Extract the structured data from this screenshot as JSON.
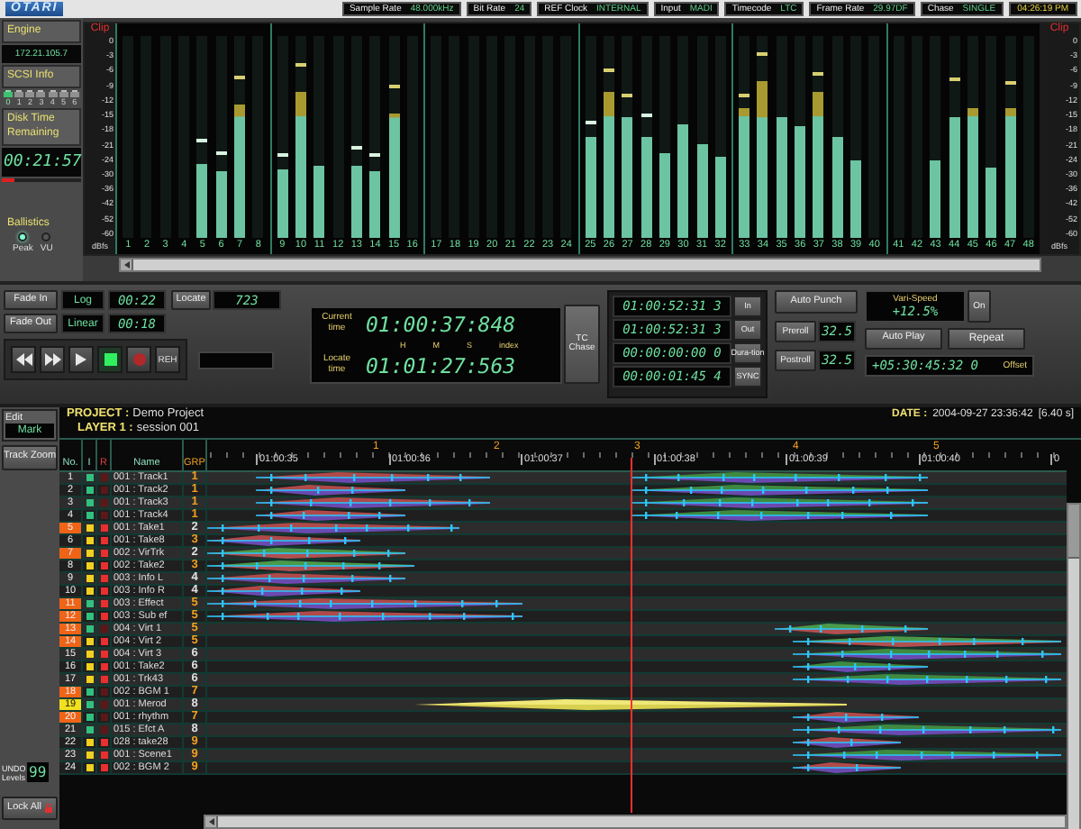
{
  "header": {
    "logo": "OTARI",
    "status": [
      {
        "label": "Sample Rate",
        "value": "48.000kHz"
      },
      {
        "label": "Bit Rate",
        "value": "24"
      },
      {
        "label": "REF Clock",
        "value": "INTERNAL"
      },
      {
        "label": "Input",
        "value": "MADI"
      },
      {
        "label": "Timecode",
        "value": "LTC"
      },
      {
        "label": "Frame Rate",
        "value": "29.97DF"
      },
      {
        "label": "Chase",
        "value": "SINGLE"
      }
    ],
    "clock": "04:26:19 PM"
  },
  "engine": {
    "title": "Engine",
    "address": "172.21.105.7",
    "scsi": "SCSI Info",
    "disks": [
      {
        "label": "0",
        "active": true
      },
      {
        "label": "1",
        "active": false
      },
      {
        "label": "2",
        "active": false
      },
      {
        "label": "3",
        "active": false
      },
      {
        "label": "4",
        "active": false
      },
      {
        "label": "5",
        "active": false
      },
      {
        "label": "6",
        "active": false
      }
    ],
    "disk_time_label": "Disk Time Remaining",
    "disk_time": "00:21:57",
    "disk_usage": {
      "level": 0.15
    },
    "ballistics": {
      "title": "Ballistics",
      "options": [
        {
          "label": "Peak",
          "selected": true
        },
        {
          "label": "VU",
          "selected": false
        }
      ]
    }
  },
  "meters": {
    "left_scale": {
      "clip": "Clip",
      "marks": [
        "0",
        "-3",
        "-6",
        "-9",
        "-12",
        "-15",
        "-18",
        "-21",
        "-24",
        "-30",
        "-36",
        "-42",
        "-52",
        "-60"
      ],
      "unit": "dBfs"
    },
    "right_scale": {
      "clip": "Clip",
      "marks": [
        "0",
        "-3",
        "-6",
        "-9",
        "-12",
        "-15",
        "-18",
        "-21",
        "-24",
        "-30",
        "-36",
        "-42",
        "-52",
        "-60"
      ],
      "unit": "dBfs"
    },
    "channels": [
      {
        "label": "1",
        "level": 0
      },
      {
        "label": "2",
        "level": 0
      },
      {
        "label": "3",
        "level": 0
      },
      {
        "label": "4",
        "level": 0
      },
      {
        "label": "5",
        "level": 0.37,
        "peak": {
          "level": 0.47
        }
      },
      {
        "label": "6",
        "level": 0.33,
        "peak": {
          "level": 0.41
        }
      },
      {
        "label": "7",
        "level": 0.66,
        "peak": {
          "level": 0.79
        }
      },
      {
        "label": "8",
        "level": 0
      },
      {
        "label": "9",
        "level": 0.34,
        "peak": {
          "level": 0.4
        }
      },
      {
        "label": "10",
        "level": 0.72,
        "peak": {
          "level": 0.85
        }
      },
      {
        "label": "11",
        "level": 0.36
      },
      {
        "label": "12",
        "level": 0
      },
      {
        "label": "13",
        "level": 0.36,
        "peak": {
          "level": 0.44
        }
      },
      {
        "label": "14",
        "level": 0.33,
        "peak": {
          "level": 0.4
        }
      },
      {
        "label": "15",
        "level": 0.62,
        "peak": {
          "level": 0.74
        }
      },
      {
        "label": "16",
        "level": 0
      },
      {
        "label": "17",
        "level": 0
      },
      {
        "label": "18",
        "level": 0
      },
      {
        "label": "19",
        "level": 0
      },
      {
        "label": "20",
        "level": 0
      },
      {
        "label": "21",
        "level": 0
      },
      {
        "label": "22",
        "level": 0
      },
      {
        "label": "23",
        "level": 0
      },
      {
        "label": "24",
        "level": 0
      },
      {
        "label": "25",
        "level": 0.5,
        "peak": {
          "level": 0.56
        }
      },
      {
        "label": "26",
        "level": 0.72,
        "peak": {
          "level": 0.82
        }
      },
      {
        "label": "27",
        "level": 0.6,
        "peak": {
          "level": 0.7
        }
      },
      {
        "label": "28",
        "level": 0.5,
        "peak": {
          "level": 0.6
        }
      },
      {
        "label": "29",
        "level": 0.42
      },
      {
        "label": "30",
        "level": 0.56
      },
      {
        "label": "31",
        "level": 0.46
      },
      {
        "label": "32",
        "level": 0.4
      },
      {
        "label": "33",
        "level": 0.64,
        "peak": {
          "level": 0.7
        }
      },
      {
        "label": "34",
        "level": 0.78,
        "peak": {
          "level": 0.9
        }
      },
      {
        "label": "35",
        "level": 0.6
      },
      {
        "label": "36",
        "level": 0.55
      },
      {
        "label": "37",
        "level": 0.72,
        "peak": {
          "level": 0.8
        }
      },
      {
        "label": "38",
        "level": 0.5
      },
      {
        "label": "39",
        "level": 0.38
      },
      {
        "label": "40",
        "level": 0
      },
      {
        "label": "41",
        "level": 0
      },
      {
        "label": "42",
        "level": 0
      },
      {
        "label": "43",
        "level": 0.38
      },
      {
        "label": "44",
        "level": 0.6,
        "peak": {
          "level": 0.78
        }
      },
      {
        "label": "45",
        "level": 0.64
      },
      {
        "label": "46",
        "level": 0.35
      },
      {
        "label": "47",
        "level": 0.64,
        "peak": {
          "level": 0.76
        }
      },
      {
        "label": "48",
        "level": 0
      }
    ]
  },
  "transport": {
    "fades": [
      {
        "button": "Fade In",
        "curve": "Log",
        "time": "00:22"
      },
      {
        "button": "Fade Out",
        "curve": "Linear",
        "time": "00:18"
      }
    ],
    "locate": {
      "button": "Locate",
      "value": "723"
    },
    "buttons": [
      {
        "kind": "rewind",
        "active": false
      },
      {
        "kind": "forward",
        "active": false
      },
      {
        "kind": "play",
        "active": false
      },
      {
        "kind": "stop",
        "active": true
      },
      {
        "kind": "record",
        "active": false
      },
      {
        "kind": "rehearse",
        "label": "REH",
        "active": false
      }
    ],
    "current_label": "Current time",
    "current": "01:00:37:848",
    "units": [
      "H",
      "M",
      "S",
      "index"
    ],
    "locate_label": "Locate time",
    "locate_time": "01:01:27:563",
    "chase": "TC Chase",
    "punch": [
      {
        "value": "01:00:52:31 3",
        "button": "In"
      },
      {
        "value": "01:00:52:31 3",
        "button": "Out"
      },
      {
        "value": "00:00:00:00 0",
        "button": "Dura-tion"
      },
      {
        "value": "00:00:01:45 4",
        "button": "SYNC"
      }
    ],
    "auto_punch": "Auto Punch",
    "preroll": {
      "button": "Preroll",
      "value": "32.5"
    },
    "postroll": {
      "button": "Postroll",
      "value": "32.5"
    },
    "varispeed": {
      "label": "Vari-Speed",
      "value": "+12.5%",
      "button": "On"
    },
    "auto_play": "Auto Play",
    "repeat": "Repeat",
    "offset": {
      "value": "+05:30:45:32 0",
      "label": "Offset"
    }
  },
  "editor": {
    "edit_label": "Edit",
    "mode": "Mark",
    "track_zoom": "Track Zoom",
    "undo_label": "UNDO Levels",
    "undo": "99",
    "lock_all": "Lock All",
    "project_label": "PROJECT :",
    "project": "Demo Project",
    "layer_label": "LAYER 1 :",
    "layer": "session 001",
    "date_label": "DATE :",
    "date": "2004-09-27 23:36:42",
    "length": "[6.40 s]",
    "columns": [
      "No.",
      "I",
      "R",
      "Name",
      "GRP"
    ],
    "markers": [
      "1",
      "2",
      "3",
      "4",
      "5"
    ],
    "times": [
      "01:00:35",
      "01:00:36",
      "01:00:37",
      "01:00:38",
      "01:00:39",
      "01:00:40",
      "0"
    ],
    "tracks": [
      {
        "no": "1",
        "selected": false,
        "current": false,
        "input": false,
        "rec": false,
        "name": "001 : Track1",
        "grp": "1",
        "color": "#f0a020"
      },
      {
        "no": "2",
        "selected": false,
        "current": false,
        "input": false,
        "rec": false,
        "name": "001 : Track2",
        "grp": "1",
        "color": "#f0a020"
      },
      {
        "no": "3",
        "selected": false,
        "current": false,
        "input": false,
        "rec": false,
        "name": "001 : Track3",
        "grp": "1",
        "color": "#f0a020"
      },
      {
        "no": "4",
        "selected": false,
        "current": false,
        "input": false,
        "rec": false,
        "name": "001 : Track4",
        "grp": "1",
        "color": "#f0a020"
      },
      {
        "no": "5",
        "selected": true,
        "current": false,
        "input": true,
        "rec": true,
        "name": "001 : Take1",
        "grp": "2",
        "color": "#e0e0e0"
      },
      {
        "no": "6",
        "selected": false,
        "current": false,
        "input": true,
        "rec": true,
        "name": "001 : Take8",
        "grp": "3",
        "color": "#f0a020"
      },
      {
        "no": "7",
        "selected": true,
        "current": false,
        "input": true,
        "rec": true,
        "name": "002 : VirTrk",
        "grp": "2",
        "color": "#e0e0e0"
      },
      {
        "no": "8",
        "selected": false,
        "current": false,
        "input": true,
        "rec": true,
        "name": "002 : Take2",
        "grp": "3",
        "color": "#f0a020"
      },
      {
        "no": "9",
        "selected": false,
        "current": false,
        "input": true,
        "rec": true,
        "name": "003 : Info L",
        "grp": "4",
        "color": "#e0e0e0"
      },
      {
        "no": "10",
        "selected": false,
        "current": false,
        "input": true,
        "rec": true,
        "name": "003 : Info R",
        "grp": "4",
        "color": "#e0e0e0"
      },
      {
        "no": "11",
        "selected": true,
        "current": false,
        "input": false,
        "rec": true,
        "name": "003 : Effect",
        "grp": "5",
        "color": "#f0a020"
      },
      {
        "no": "12",
        "selected": true,
        "current": false,
        "input": false,
        "rec": true,
        "name": "003 : Sub ef",
        "grp": "5",
        "color": "#f0a020"
      },
      {
        "no": "13",
        "selected": true,
        "current": false,
        "input": false,
        "rec": false,
        "name": "004 : Virt 1",
        "grp": "5",
        "color": "#f0a020"
      },
      {
        "no": "14",
        "selected": true,
        "current": false,
        "input": true,
        "rec": true,
        "name": "004 : Virt 2",
        "grp": "5",
        "color": "#f0a020"
      },
      {
        "no": "15",
        "selected": false,
        "current": false,
        "input": true,
        "rec": true,
        "name": "004 : Virt 3",
        "grp": "6",
        "color": "#e0e0e0"
      },
      {
        "no": "16",
        "selected": false,
        "current": false,
        "input": true,
        "rec": true,
        "name": "001 : Take2",
        "grp": "6",
        "color": "#e0e0e0"
      },
      {
        "no": "17",
        "selected": false,
        "current": false,
        "input": true,
        "rec": true,
        "name": "001 : Trk43",
        "grp": "6",
        "color": "#e0e0e0"
      },
      {
        "no": "18",
        "selected": true,
        "current": false,
        "input": false,
        "rec": false,
        "name": "002 : BGM 1",
        "grp": "7",
        "color": "#f0a020"
      },
      {
        "no": "19",
        "selected": false,
        "current": true,
        "input": false,
        "rec": false,
        "name": "001 : Merod",
        "grp": "8",
        "color": "#e0e0e0"
      },
      {
        "no": "20",
        "selected": true,
        "current": false,
        "input": false,
        "rec": false,
        "name": "001 : rhythm",
        "grp": "7",
        "color": "#f0a020"
      },
      {
        "no": "21",
        "selected": false,
        "current": false,
        "input": false,
        "rec": false,
        "name": "015 : Efct A",
        "grp": "8",
        "color": "#e0e0e0"
      },
      {
        "no": "22",
        "selected": false,
        "current": false,
        "input": true,
        "rec": true,
        "name": "028 : take28",
        "grp": "9",
        "color": "#f0a020"
      },
      {
        "no": "23",
        "selected": false,
        "current": false,
        "input": true,
        "rec": true,
        "name": "001 : Scene1",
        "grp": "9",
        "color": "#f0a020"
      },
      {
        "no": "24",
        "selected": false,
        "current": false,
        "input": true,
        "rec": true,
        "name": "002 : BGM 2",
        "grp": "9",
        "color": "#f0a020"
      }
    ]
  }
}
